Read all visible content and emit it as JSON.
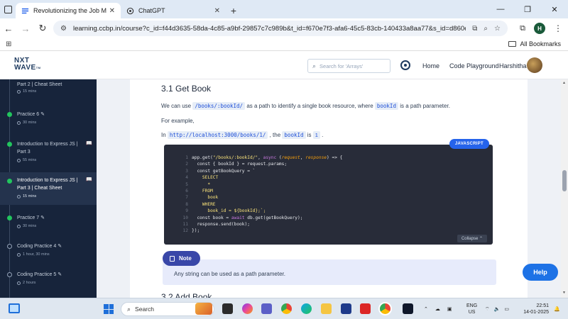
{
  "browser": {
    "tabs": [
      {
        "title": "Revolutionizing the Job Market",
        "active": true
      },
      {
        "title": "ChatGPT",
        "active": false
      }
    ],
    "url": "learning.ccbp.in/course?c_id=f44d3635-58da-4c85-a9bf-29857c7c989b&t_id=f670e7f3-afa6-45c5-83cb-140433a8aa77&s_id=d860e2ea-d1c...",
    "profile_initial": "H",
    "all_bookmarks": "All Bookmarks"
  },
  "header": {
    "logo_top": "NXT",
    "logo_bottom": "WAVE",
    "logo_suffix": "TM",
    "search_placeholder": "Search for 'Arrays'",
    "nav": {
      "home": "Home",
      "playground": "Code Playground",
      "user": "Harshitha"
    }
  },
  "sidebar": {
    "items": [
      {
        "title": "Part 2 | Cheat Sheet",
        "time": "15 mins",
        "done": true
      },
      {
        "title": "Practice 6",
        "time": "30 mins",
        "done": true
      },
      {
        "title": "Introduction to Express JS | Part 3",
        "time": "55 mins",
        "done": true
      },
      {
        "title": "Introduction to Express JS | Part 3 | Cheat Sheet",
        "time": "15 mins",
        "done": true,
        "active": true
      },
      {
        "title": "Practice 7",
        "time": "30 mins",
        "done": true
      },
      {
        "title": "Coding Practice 4",
        "time": "1 hour, 30 mins",
        "done": false
      },
      {
        "title": "Coding Practice 5",
        "time": "2 hours",
        "done": false
      }
    ]
  },
  "content": {
    "heading": "3.1 Get Book",
    "p1_before": "We can use",
    "p1_code": "/books/:bookId/",
    "p1_middle": "as a path to identify a single book resource, where",
    "p1_code2": "bookId",
    "p1_after": "is a path parameter.",
    "p2": "For example,",
    "p3_in": "In",
    "p3_url": "http://localhost:3000/books/1/",
    "p3_the": ", the",
    "p3_code": "bookId",
    "p3_is": "is",
    "p3_num": "1",
    "p3_end": ".",
    "code_lang": "JAVASCRIPT",
    "collapse": "Collapse",
    "note_label": "Note",
    "note_text": "Any string can be used as a path parameter.",
    "next_heading": "3.2 Add Book"
  },
  "code": {
    "lines": [
      [
        "app.get(",
        "\"/books/:bookId/\"",
        ", ",
        "async",
        " (",
        "request",
        ", ",
        "response",
        ") => {"
      ],
      [
        "  const { bookId } = request.params;"
      ],
      [
        "  const getBookQuery = `"
      ],
      [
        "    SELECT"
      ],
      [
        "      *"
      ],
      [
        "    FROM"
      ],
      [
        "      book"
      ],
      [
        "    WHERE"
      ],
      [
        "      book_id = ${bookId};`;"
      ],
      [
        "  const book = ",
        "await",
        " db.get(getBookQuery);"
      ],
      [
        "  response.send(book);"
      ],
      [
        "});"
      ]
    ]
  },
  "help_label": "Help",
  "taskbar": {
    "search": "Search",
    "lang_top": "ENG",
    "lang_bottom": "US",
    "time": "22:51",
    "date": "14-01-2025"
  }
}
